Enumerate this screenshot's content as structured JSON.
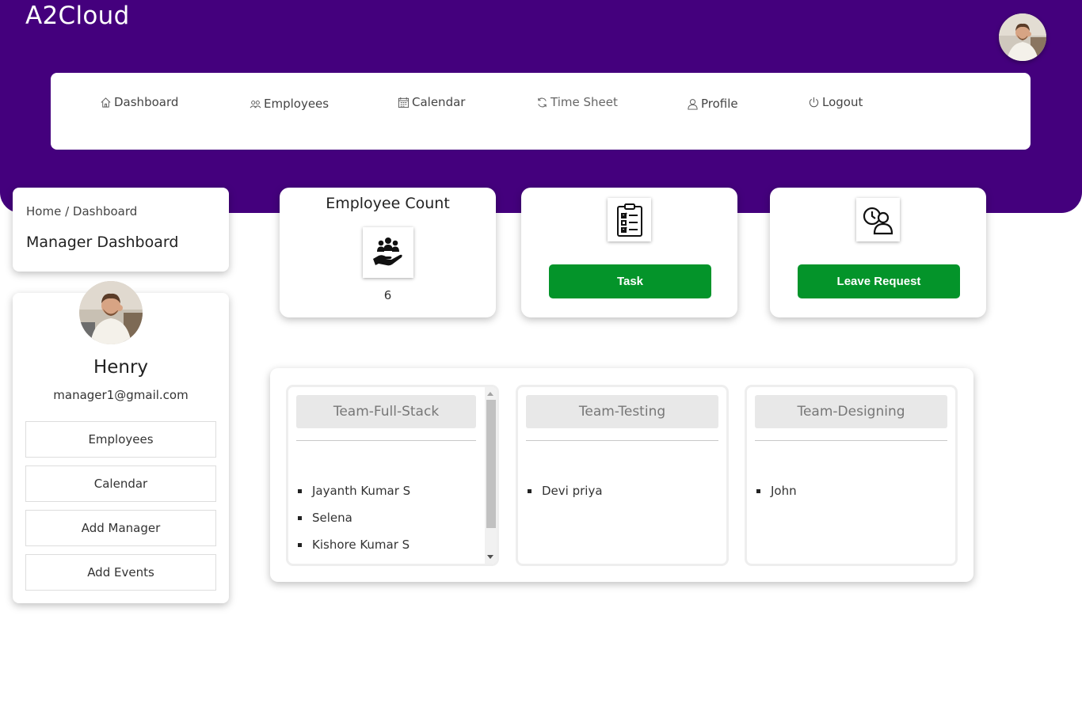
{
  "app": {
    "brand": "A2Cloud"
  },
  "nav": {
    "items": [
      {
        "label": "Dashboard",
        "icon": "home-icon"
      },
      {
        "label": "Employees",
        "icon": "users-icon"
      },
      {
        "label": "Calendar",
        "icon": "calendar-icon"
      },
      {
        "label": "Time Sheet",
        "icon": "refresh-icon"
      },
      {
        "label": "Profile",
        "icon": "user-icon"
      },
      {
        "label": "Logout",
        "icon": "power-icon"
      }
    ]
  },
  "breadcrumb": {
    "home": "Home",
    "separator": "/",
    "current": "Dashboard"
  },
  "page": {
    "title": "Manager Dashboard"
  },
  "profile": {
    "name": "Henry",
    "email": "manager1@gmail.com",
    "buttons": [
      "Employees",
      "Calendar",
      "Add Manager",
      "Add Events"
    ]
  },
  "stats": {
    "employee_count": {
      "title": "Employee Count",
      "value": "6",
      "icon": "team-hand-icon"
    },
    "task": {
      "button_label": "Task",
      "icon": "clipboard-checklist-icon"
    },
    "leave": {
      "button_label": "Leave Request",
      "icon": "user-clock-icon"
    }
  },
  "teams": [
    {
      "name": "Team-Full-Stack",
      "members": [
        "Jayanth Kumar S",
        "Selena",
        "Kishore Kumar S"
      ]
    },
    {
      "name": "Team-Testing",
      "members": [
        "Devi priya"
      ]
    },
    {
      "name": "Team-Designing",
      "members": [
        "John"
      ]
    }
  ],
  "colors": {
    "header_bg": "#44007d",
    "button_green": "#04942a"
  }
}
